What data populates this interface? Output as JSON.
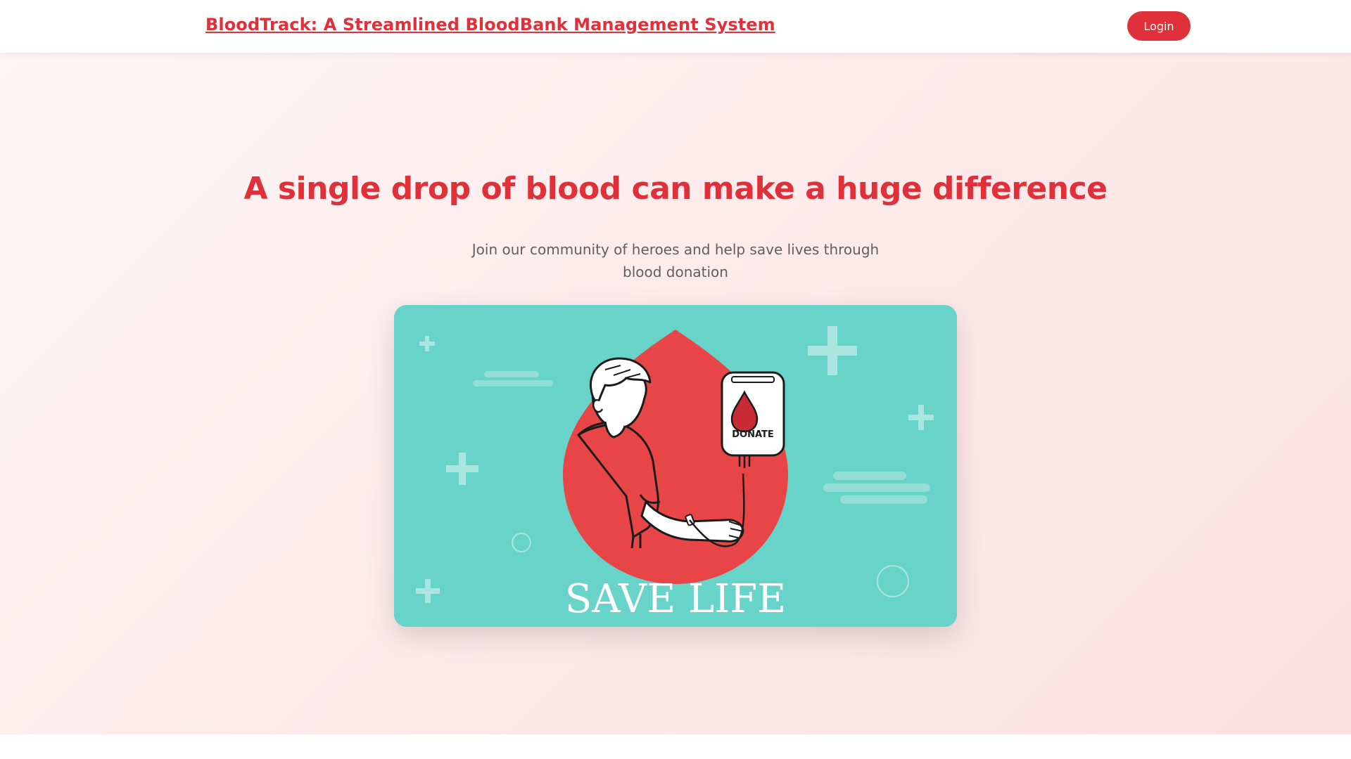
{
  "navbar": {
    "brand": "BloodTrack: A Streamlined BloodBank Management System",
    "login_label": "Login"
  },
  "hero": {
    "title": "A single drop of blood can make a huge difference",
    "subtitle": "Join our community of heroes and help save lives through blood donation"
  },
  "illustration": {
    "bag_label": "DONATE",
    "caption": "SAVE LIFE"
  },
  "colors": {
    "accent": "#e0313a",
    "teal": "#68d3c8",
    "drop": "#e84646"
  }
}
